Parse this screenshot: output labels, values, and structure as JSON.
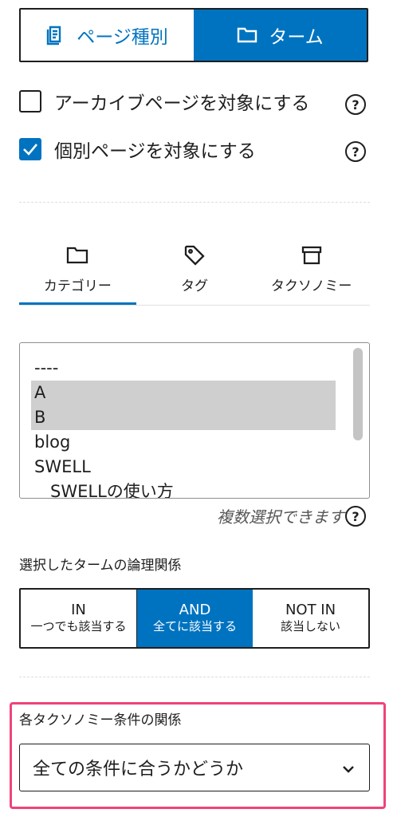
{
  "scope_toggle": {
    "page_type_label": "ページ種別",
    "term_label": "ターム",
    "selected": "ターム"
  },
  "checkboxes": [
    {
      "label": "アーカイブページを対象にする",
      "checked": false
    },
    {
      "label": "個別ページを対象にする",
      "checked": true
    }
  ],
  "help_glyph": "?",
  "taxonomy_tabs": [
    {
      "label": "カテゴリー",
      "icon": "folder-icon",
      "active": true
    },
    {
      "label": "タグ",
      "icon": "tag-icon",
      "active": false
    },
    {
      "label": "タクソノミー",
      "icon": "archive-box-icon",
      "active": false
    }
  ],
  "term_list": {
    "items": [
      {
        "label": "----",
        "selected": false
      },
      {
        "label": "A",
        "selected": true
      },
      {
        "label": "B",
        "selected": true
      },
      {
        "label": "blog",
        "selected": false
      },
      {
        "label": "SWELL",
        "selected": false
      },
      {
        "label": "   SWELLの使い方",
        "selected": false
      }
    ],
    "hint": "複数選択できます"
  },
  "logic": {
    "label": "選択したタームの論理関係",
    "options": [
      {
        "title": "IN",
        "sub": "一つでも該当する",
        "selected": false
      },
      {
        "title": "AND",
        "sub": "全てに該当する",
        "selected": true
      },
      {
        "title": "NOT IN",
        "sub": "該当しない",
        "selected": false
      }
    ]
  },
  "taxonomy_relation": {
    "label": "各タクソノミー条件の関係",
    "value": "全ての条件に合うかどうか"
  },
  "colors": {
    "accent": "#0073c0",
    "highlight": "#f0427a"
  }
}
